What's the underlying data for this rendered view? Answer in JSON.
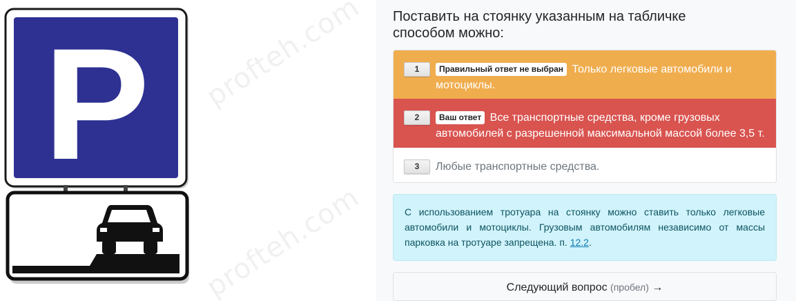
{
  "watermark_text": "profteh.com",
  "sign": {
    "letter": "P",
    "blue_color": "#2e3192"
  },
  "question": "Поставить на стоянку указанным на табличке способом можно:",
  "answers": [
    {
      "number": "1",
      "badge": "Правильный ответ не выбран",
      "text": "Только легковые автомобили и мотоциклы.",
      "state": "correct-not-chosen",
      "color": "#f0ad4e"
    },
    {
      "number": "2",
      "badge": "Ваш ответ",
      "text": "Все транспортные средства, кроме грузовых автомобилей с разрешенной максимальной массой более 3,5 т.",
      "state": "your-answer-wrong",
      "color": "#d9534f"
    },
    {
      "number": "3",
      "badge": "",
      "text": "Любые транспортные средства.",
      "state": "neutral",
      "color": "#ffffff"
    }
  ],
  "explanation": {
    "text": "С использованием тротуара на стоянку можно ставить только легковые автомобили и мотоциклы. Грузовым автомобилям независимо от массы парковка на тротуаре запрещена. п.",
    "link_text": "12.2",
    "after_link": "."
  },
  "next_button": {
    "label": "Следующий вопрос",
    "hint": "(пробел)",
    "arrow": "→"
  }
}
